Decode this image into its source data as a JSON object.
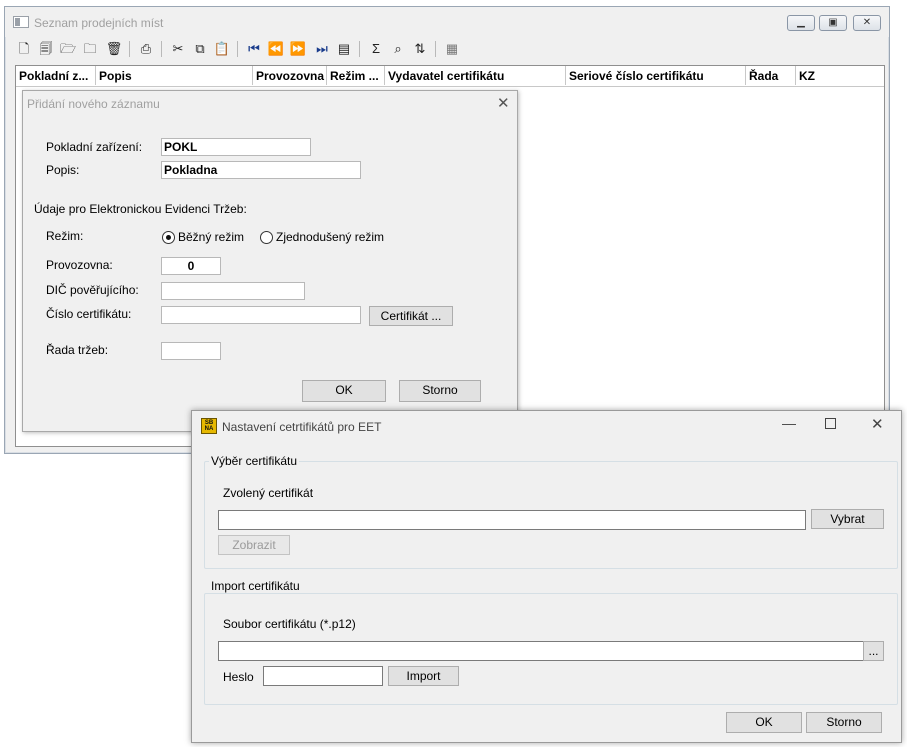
{
  "main_window": {
    "title": "Seznam prodejních míst",
    "columns": [
      "Pokladní z...",
      "Popis",
      "Provozovna",
      "Režim ...",
      "Vydavatel certifikátu",
      "Seriové číslo certifikátu",
      "Řada",
      "KZ"
    ]
  },
  "add_dialog": {
    "title": "Přidání nového záznamu",
    "pokladni_label": "Pokladní zařízení:",
    "pokladni_value": "POKL",
    "popis_label": "Popis:",
    "popis_value": "Pokladna",
    "eet_heading": "Údaje pro Elektronickou Evidenci Tržeb:",
    "rezim_label": "Režim:",
    "rezim_option1": "Běžný režim",
    "rezim_option2": "Zjednodušený režim",
    "provozovna_label": "Provozovna:",
    "provozovna_value": "0",
    "dic_label": "DIČ pověřujícího:",
    "dic_value": "",
    "cislo_label": "Číslo certifikátu:",
    "cislo_value": "",
    "certifikat_button": "Certifikát ...",
    "rada_label": "Řada tržeb:",
    "rada_value": "",
    "ok_button": "OK",
    "storno_button": "Storno"
  },
  "cert_dialog": {
    "title": "Nastavení cetrtifikátů pro EET",
    "app_icon_text": "SBNA",
    "selection_group": "Výběr certifikátu",
    "chosen_label": "Zvolený certifikát",
    "chosen_value": "",
    "vybrat_button": "Vybrat",
    "zobrazit_button": "Zobrazit",
    "import_group": "Import certifikátu",
    "file_label": "Soubor certifikátu (*.p12)",
    "file_value": "",
    "browse_button": "...",
    "heslo_label": "Heslo",
    "heslo_value": "",
    "import_button": "Import",
    "ok_button": "OK",
    "storno_button": "Storno"
  },
  "colors": {
    "window_bg": "#f0f0f0",
    "disabled_text": "#a0a0a0",
    "icon_yellow": "#e6b800"
  }
}
